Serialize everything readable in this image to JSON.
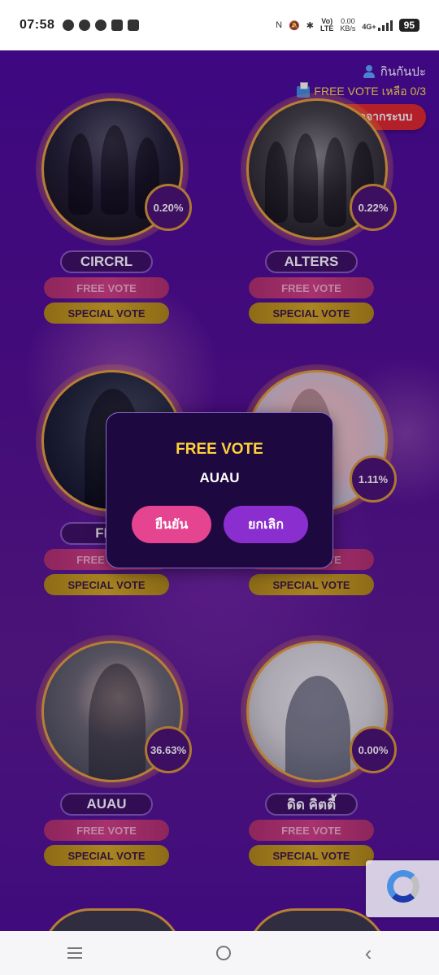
{
  "status_bar": {
    "time": "07:58",
    "net_speed": "0.00\nKB/s",
    "volte": "Vo)\nLTE",
    "network": "4G+",
    "battery": "95"
  },
  "header": {
    "username": "กินกันปะ",
    "free_vote_text": "FREE VOTE เหลือ 0/3",
    "logout_label": "ออกจากระบบ"
  },
  "artists": [
    {
      "name": "CIRCRL",
      "percent": "0.20%"
    },
    {
      "name": "ALTERS",
      "percent": "0.22%"
    },
    {
      "name": "FIR",
      "percent": ""
    },
    {
      "name": "",
      "percent": "1.11%"
    },
    {
      "name": "AUAU",
      "percent": "36.63%"
    },
    {
      "name": "ดิด คิตตี้",
      "percent": "0.00%"
    }
  ],
  "buttons": {
    "free_vote": "FREE VOTE",
    "special_vote": "SPECIAL VOTE"
  },
  "modal": {
    "title": "FREE VOTE",
    "artist": "AUAU",
    "confirm": "ยืนยัน",
    "cancel": "ยกเลิก"
  },
  "colors": {
    "background": "#4a0b9a",
    "free_vote": "#d24082",
    "special_vote": "#d4aa20",
    "logout": "#e02a2a",
    "modal_title": "#ffd23a"
  }
}
